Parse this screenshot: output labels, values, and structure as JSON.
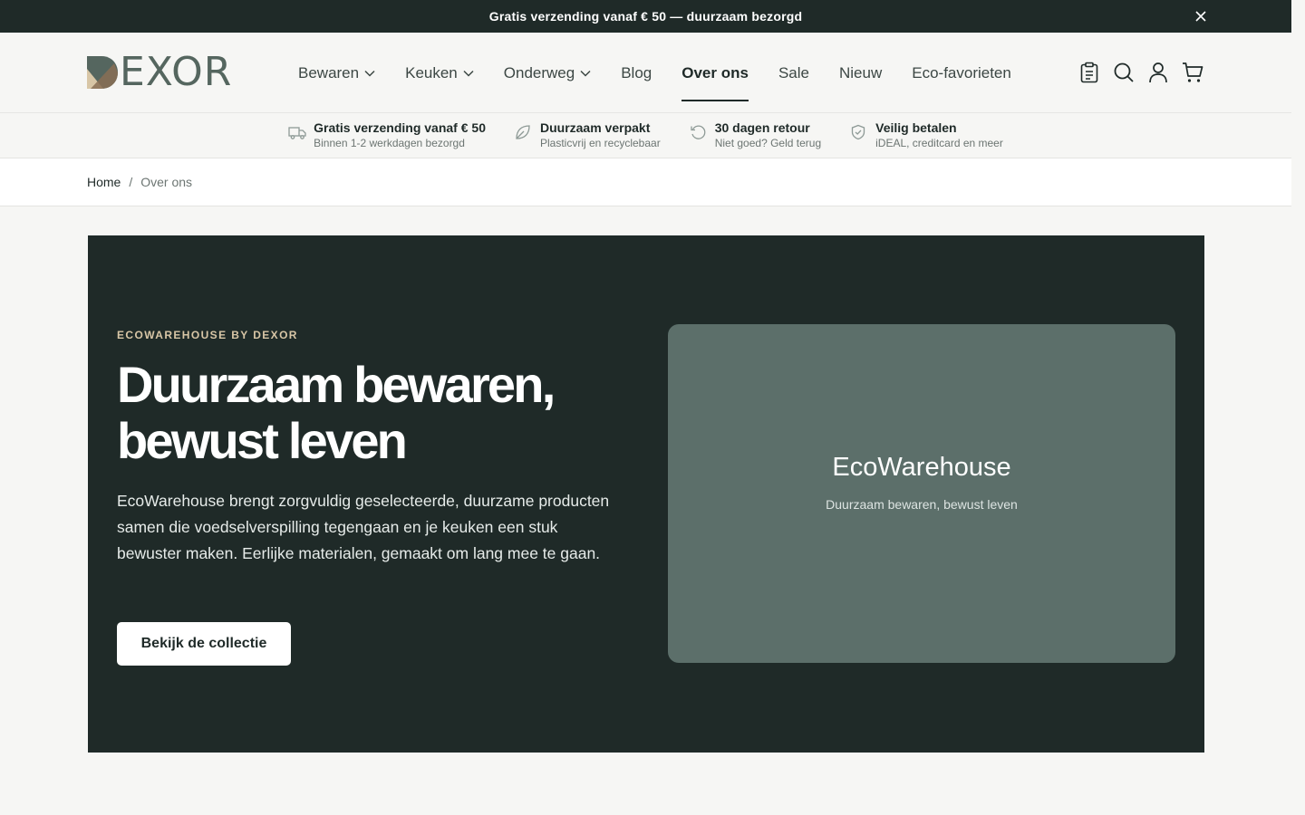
{
  "announcement": {
    "text": "Gratis verzending vanaf € 50 — duurzaam bezorgd",
    "close_icon": "close-icon"
  },
  "header": {
    "logo_text": "EXOR",
    "nav": [
      {
        "label": "Bewaren",
        "dropdown": true
      },
      {
        "label": "Keuken",
        "dropdown": true
      },
      {
        "label": "Onderweg",
        "dropdown": true
      },
      {
        "label": "Blog",
        "dropdown": false
      },
      {
        "label": "Over ons",
        "dropdown": false,
        "active": true
      },
      {
        "label": "Sale",
        "dropdown": false
      },
      {
        "label": "Nieuw",
        "dropdown": false
      },
      {
        "label": "Eco-favorieten",
        "dropdown": false
      }
    ],
    "icons": [
      "clipboard-icon",
      "search-icon",
      "user-icon",
      "cart-icon"
    ]
  },
  "usps": [
    {
      "icon": "truck-icon",
      "title": "Gratis verzending vanaf € 50",
      "subtitle": "Binnen 1-2 werkdagen bezorgd"
    },
    {
      "icon": "leaf-icon",
      "title": "Duurzaam verpakt",
      "subtitle": "Plasticvrij en recyclebaar"
    },
    {
      "icon": "return-icon",
      "title": "30 dagen retour",
      "subtitle": "Niet goed? Geld terug"
    },
    {
      "icon": "shield-check-icon",
      "title": "Veilig betalen",
      "subtitle": "iDEAL, creditcard en meer"
    }
  ],
  "breadcrumb": {
    "home": "Home",
    "separator": "/",
    "current": "Over ons"
  },
  "hero": {
    "kicker": "ECOWAREHOUSE BY DEXOR",
    "title": "Duurzaam bewaren, bewust leven",
    "description": "EcoWarehouse brengt zorgvuldig geselecteerde, duurzame producten samen die voedselverspilling tegengaan en je keuken een stuk bewuster maken. Eerlijke materialen, gemaakt om lang mee te gaan.",
    "cta_label": "Bekijk de collectie",
    "card_title": "EcoWarehouse",
    "card_subtitle": "Duurzaam bewaren, bewust leven"
  },
  "colors": {
    "dark": "#1f2a28",
    "card": "#5c6f6a",
    "accent_kicker": "#d8c6a6",
    "logo": "#55665f"
  }
}
